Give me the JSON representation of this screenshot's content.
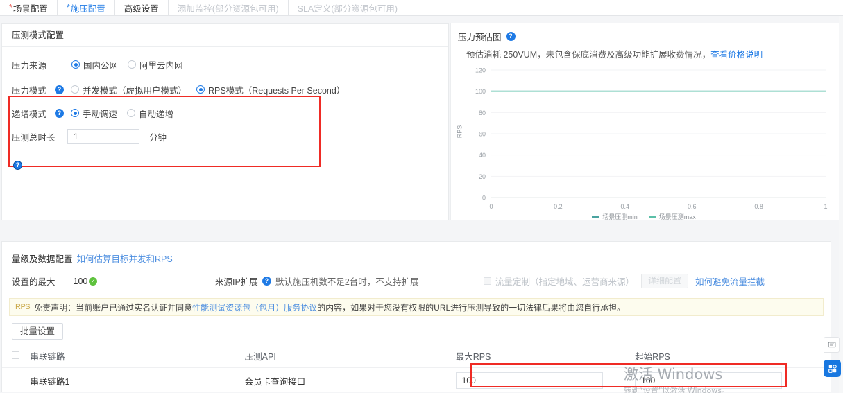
{
  "tabs": [
    {
      "label": "场景配置",
      "required": true,
      "state": "normal"
    },
    {
      "label": "施压配置",
      "required": true,
      "state": "active"
    },
    {
      "label": "高级设置",
      "required": false,
      "state": "normal"
    },
    {
      "label": "添加监控(部分资源包可用)",
      "required": false,
      "state": "disabled"
    },
    {
      "label": "SLA定义(部分资源包可用)",
      "required": false,
      "state": "disabled"
    }
  ],
  "stress_panel": {
    "title": "压测模式配置",
    "source": {
      "label": "压力来源",
      "options": [
        {
          "label": "国内公网",
          "selected": true
        },
        {
          "label": "阿里云内网",
          "selected": false
        }
      ]
    },
    "mode": {
      "label": "压力模式",
      "help": "?",
      "options": [
        {
          "label": "并发模式（虚拟用户模式）",
          "selected": false
        },
        {
          "label": "RPS模式（Requests Per Second）",
          "selected": true
        }
      ]
    },
    "ramp": {
      "label": "递增模式",
      "help": "?",
      "options": [
        {
          "label": "手动调速",
          "selected": true
        },
        {
          "label": "自动递增",
          "selected": false
        }
      ]
    },
    "duration": {
      "label": "压测总时长",
      "value": "1",
      "placeholder": "",
      "unit": "分钟",
      "help": "?"
    }
  },
  "chart_panel": {
    "title": "压力预估图",
    "help": "?",
    "subtitle_prefix": "预估消耗 250VUM，未包含保底消费及高级功能扩展收费情况，",
    "subtitle_link": "查看价格说明"
  },
  "chart_data": {
    "type": "line",
    "title": "压力预估图",
    "xlabel": "",
    "ylabel": "RPS",
    "xlim": [
      0,
      1
    ],
    "ylim": [
      0,
      120
    ],
    "xticks": [
      "0",
      "0.2",
      "0.4",
      "0.6",
      "0.8",
      "1"
    ],
    "yticks": [
      "0",
      "20",
      "40",
      "60",
      "80",
      "100",
      "120"
    ],
    "grid": true,
    "legend_position": "bottom",
    "series": [
      {
        "name": "场景压测min",
        "color": "#4aa3a0",
        "x": [
          0,
          1
        ],
        "values": [
          100,
          100
        ]
      },
      {
        "name": "场景压测max",
        "color": "#5bc0a8",
        "x": [
          0,
          1
        ],
        "values": [
          100,
          100
        ]
      }
    ]
  },
  "volume_panel": {
    "title": "量级及数据配置",
    "title_link": "如何估算目标并发和RPS",
    "max_label": "设置的最大",
    "max_value": "100",
    "max_ok_icon": "check-icon",
    "ip_label": "来源IP扩展",
    "ip_help": "?",
    "ip_hint": "默认施压机数不足2台时，不支持扩展",
    "traffic_checkbox_label": "流量定制（指定地域、运营商来源）",
    "traffic_detail_button": "详细配置",
    "traffic_link": "如何避免流量拦截",
    "notice_badge": "RPS",
    "notice_a": "免责声明：当前账户已通过实名认证并同意",
    "notice_link1": "性能测试资源包（包月）服务协议",
    "notice_b": "的内容，如果对于您没有权限的URL进行压测导致的一切法律后果将由您自行承担。",
    "batch_button": "批量设置"
  },
  "table": {
    "columns": [
      "串联链路",
      "压测API",
      "最大RPS",
      "起始RPS"
    ],
    "rows": [
      {
        "chain": "串联链路1",
        "api": "会员卡查询接口",
        "max_rps": "100",
        "start_rps": "100"
      }
    ]
  },
  "side_widgets": {
    "feedback_icon": "feedback-icon",
    "apps_icon": "apps-grid-icon"
  },
  "watermark": {
    "line1": "激活 Windows",
    "line2": "转到“设置”以激活 Windows。"
  }
}
